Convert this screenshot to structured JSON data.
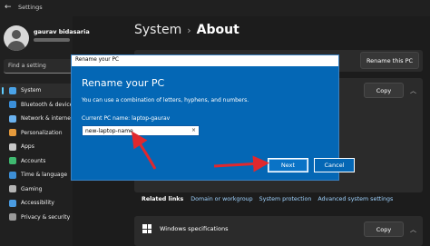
{
  "window": {
    "title": "Settings",
    "back_glyph": "←"
  },
  "user": {
    "name": "gaurav bidasaria"
  },
  "search": {
    "placeholder": "Find a setting"
  },
  "sidebar": {
    "items": [
      {
        "label": "System",
        "icon": "monitor-icon",
        "color": "#4aa3e8",
        "active": true
      },
      {
        "label": "Bluetooth & devices",
        "icon": "bluetooth-icon",
        "color": "#3b8fd9",
        "active": false
      },
      {
        "label": "Network & internet",
        "icon": "wifi-icon",
        "color": "#6ab2f0",
        "active": false
      },
      {
        "label": "Personalization",
        "icon": "brush-icon",
        "color": "#e59a3c",
        "active": false
      },
      {
        "label": "Apps",
        "icon": "apps-icon",
        "color": "#c9c9c9",
        "active": false
      },
      {
        "label": "Accounts",
        "icon": "account-icon",
        "color": "#3fb970",
        "active": false
      },
      {
        "label": "Time & language",
        "icon": "clock-icon",
        "color": "#3d8fd6",
        "active": false
      },
      {
        "label": "Gaming",
        "icon": "gamepad-icon",
        "color": "#b5b5b5",
        "active": false
      },
      {
        "label": "Accessibility",
        "icon": "accessibility-icon",
        "color": "#4a9be0",
        "active": false
      },
      {
        "label": "Privacy & security",
        "icon": "shield-icon",
        "color": "#9a9a9a",
        "active": false
      }
    ]
  },
  "header": {
    "breadcrumb_parent": "System",
    "breadcrumb_sep": "›",
    "title": "About"
  },
  "pc_card": {
    "rename_button": "Rename this PC"
  },
  "device_spec": {
    "copy_button": "Copy"
  },
  "related_links": {
    "title": "Related links",
    "links": [
      "Domain or workgroup",
      "System protection",
      "Advanced system settings"
    ]
  },
  "windows_spec": {
    "label": "Windows specifications",
    "copy_button": "Copy"
  },
  "dialog": {
    "window_title": "Rename your PC",
    "heading": "Rename your PC",
    "description": "You can use a combination of letters, hyphens, and numbers.",
    "current_name_label": "Current PC name: laptop-gaurav",
    "input_value": "new-laptop-name",
    "clear_glyph": "×",
    "next_button": "Next",
    "cancel_button": "Cancel"
  },
  "colors": {
    "accent": "#60cdff",
    "dialog_bg": "#0467b5",
    "arrow": "#e0282e"
  }
}
